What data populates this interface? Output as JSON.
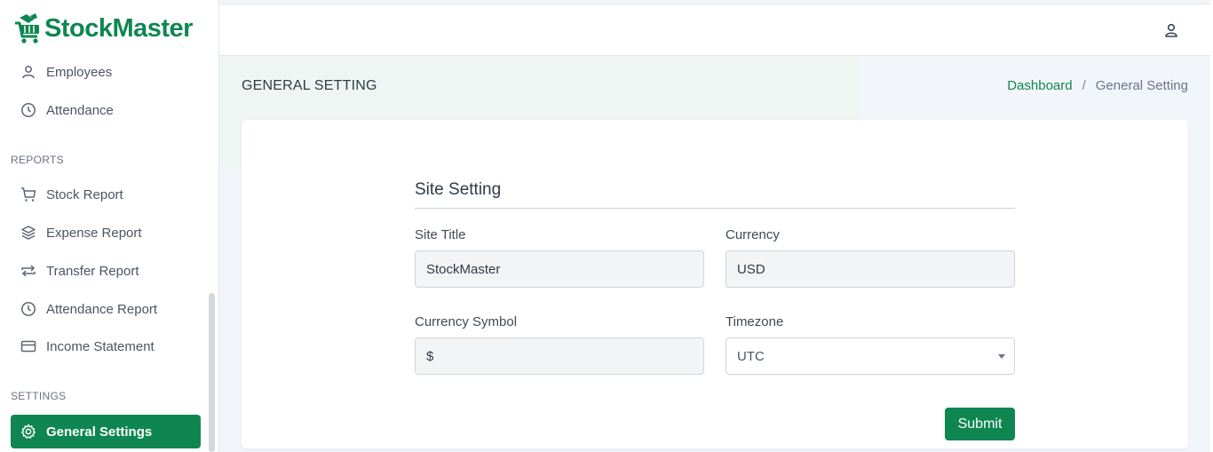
{
  "brand": {
    "name": "StockMaster",
    "color": "#0f8651"
  },
  "sidebar": {
    "items_top": [
      {
        "label": "Employees",
        "icon": "user-icon"
      },
      {
        "label": "Attendance",
        "icon": "clock-icon"
      }
    ],
    "reports_title": "REPORTS",
    "reports": [
      {
        "label": "Stock Report",
        "icon": "cart-icon"
      },
      {
        "label": "Expense Report",
        "icon": "layers-icon"
      },
      {
        "label": "Transfer Report",
        "icon": "transfer-icon"
      },
      {
        "label": "Attendance Report",
        "icon": "clock-icon"
      },
      {
        "label": "Income Statement",
        "icon": "card-icon"
      }
    ],
    "settings_title": "SETTINGS",
    "settings": [
      {
        "label": "General Settings",
        "icon": "gear-icon",
        "active": true
      }
    ]
  },
  "header": {
    "user_icon": "user-icon"
  },
  "page": {
    "title": "GENERAL SETTING",
    "breadcrumb": {
      "home": "Dashboard",
      "separator": "/",
      "current": "General Setting"
    }
  },
  "form": {
    "heading": "Site Setting",
    "site_title": {
      "label": "Site Title",
      "value": "StockMaster"
    },
    "currency": {
      "label": "Currency",
      "value": "USD"
    },
    "currency_symbol": {
      "label": "Currency Symbol",
      "value": "$"
    },
    "timezone": {
      "label": "Timezone",
      "value": "UTC"
    },
    "submit_label": "Submit"
  }
}
